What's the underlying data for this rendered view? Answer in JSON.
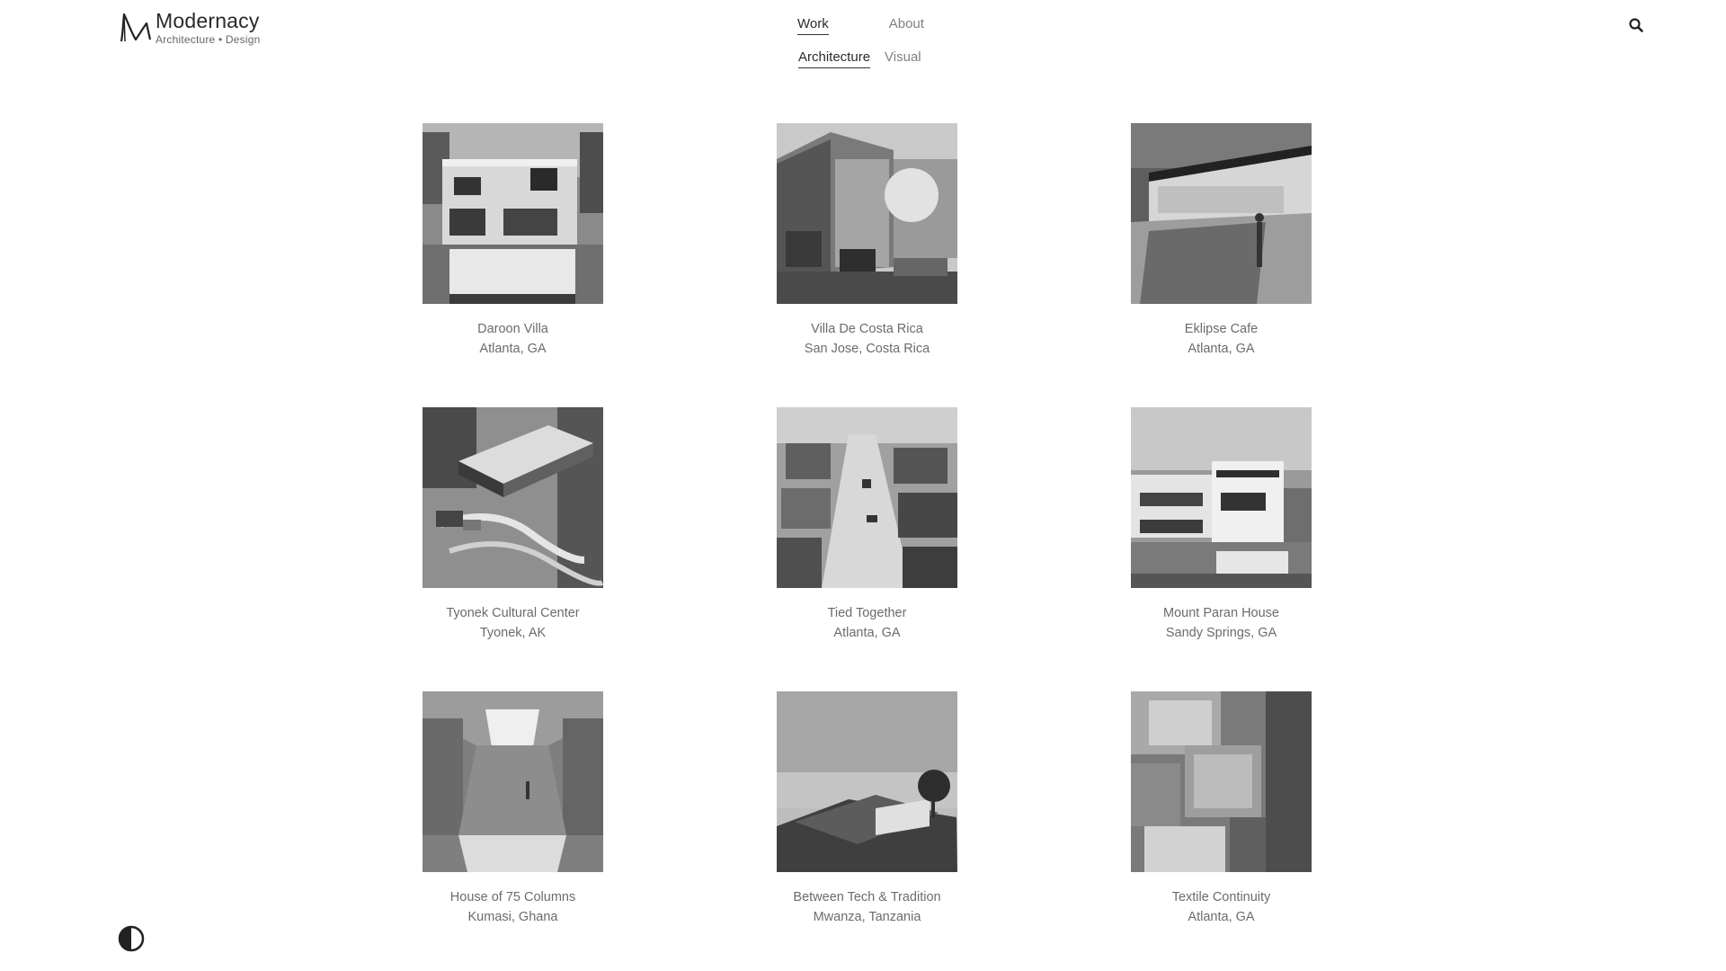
{
  "brand": {
    "name": "Modernacy",
    "tagline": "Architecture • Design"
  },
  "nav": {
    "primary": [
      {
        "label": "Work",
        "active": true
      },
      {
        "label": "About",
        "active": false
      }
    ],
    "secondary": [
      {
        "label": "Architecture",
        "active": true
      },
      {
        "label": "Visual",
        "active": false
      }
    ]
  },
  "icons": {
    "search": "search-icon",
    "contrast": "contrast-icon"
  },
  "projects": [
    {
      "title": "Daroon Villa",
      "location": "Atlanta, GA"
    },
    {
      "title": "Villa De Costa Rica",
      "location": "San Jose, Costa Rica"
    },
    {
      "title": "Eklipse Cafe",
      "location": "Atlanta, GA"
    },
    {
      "title": "Tyonek Cultural Center",
      "location": "Tyonek, AK"
    },
    {
      "title": "Tied Together",
      "location": "Atlanta, GA"
    },
    {
      "title": "Mount Paran House",
      "location": "Sandy Springs, GA"
    },
    {
      "title": "House of 75 Columns",
      "location": "Kumasi, Ghana"
    },
    {
      "title": "Between Tech & Tradition",
      "location": "Mwanza, Tanzania"
    },
    {
      "title": "Textile Continuity",
      "location": "Atlanta, GA"
    }
  ],
  "colors": {
    "background": "#ffffff",
    "text": "#6b6b6b",
    "active": "#2b2b2b"
  }
}
